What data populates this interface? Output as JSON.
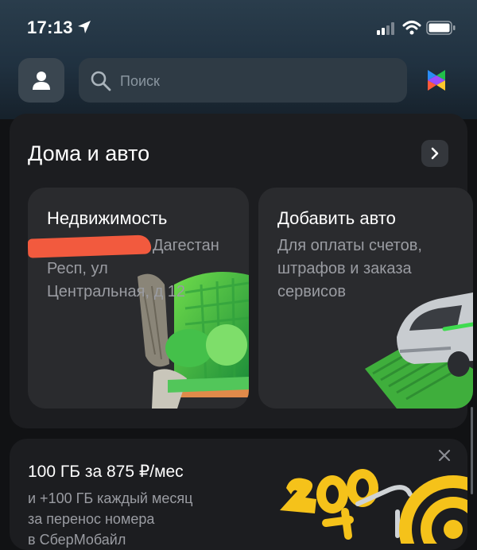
{
  "status_bar": {
    "time": "17:13"
  },
  "header": {
    "search": {
      "placeholder": "Поиск"
    }
  },
  "section": {
    "title": "Дома и авто",
    "cards": [
      {
        "title": "Недвижимость",
        "subtitle_lines": [
          "Дагестан",
          "Респ, ул",
          "Центральная, д 12"
        ]
      },
      {
        "title": "Добавить авто",
        "subtitle_lines": [
          "Для оплаты счетов,",
          "штрафов и заказа",
          "сервисов"
        ]
      }
    ]
  },
  "promo": {
    "title": "100 ГБ за 875 ₽/мес",
    "subtitle_lines": [
      "и +100 ГБ каждый месяц",
      "за перенос номера",
      "в СберМобайл"
    ]
  },
  "colors": {
    "accent": "#21a038",
    "redaction": "#f25a3e",
    "card": "#2a2b2e"
  }
}
